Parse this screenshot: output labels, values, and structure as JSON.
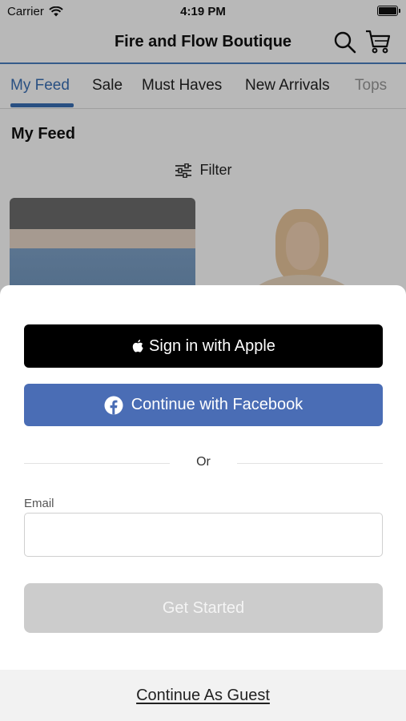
{
  "status_bar": {
    "carrier": "Carrier",
    "time": "4:19 PM"
  },
  "header": {
    "title": "Fire and Flow Boutique",
    "search_icon": "search-icon",
    "cart_icon": "cart-icon"
  },
  "tabs": [
    {
      "label": "My Feed",
      "active": true
    },
    {
      "label": "Sale",
      "active": false
    },
    {
      "label": "Must Haves",
      "active": false
    },
    {
      "label": "New Arrivals",
      "active": false
    },
    {
      "label": "Tops",
      "active": false
    }
  ],
  "feed": {
    "title": "My Feed",
    "filter_label": "Filter",
    "filter_icon": "sliders-icon"
  },
  "sheet": {
    "apple_button": "Sign in with Apple",
    "facebook_button": "Continue with Facebook",
    "divider_text": "Or",
    "email_label": "Email",
    "email_value": "",
    "get_started_button": "Get Started",
    "guest_link": "Continue As Guest"
  },
  "colors": {
    "accent": "#3a6fb5",
    "facebook": "#4a6db5",
    "apple": "#000000",
    "disabled_button": "#cccccc"
  }
}
